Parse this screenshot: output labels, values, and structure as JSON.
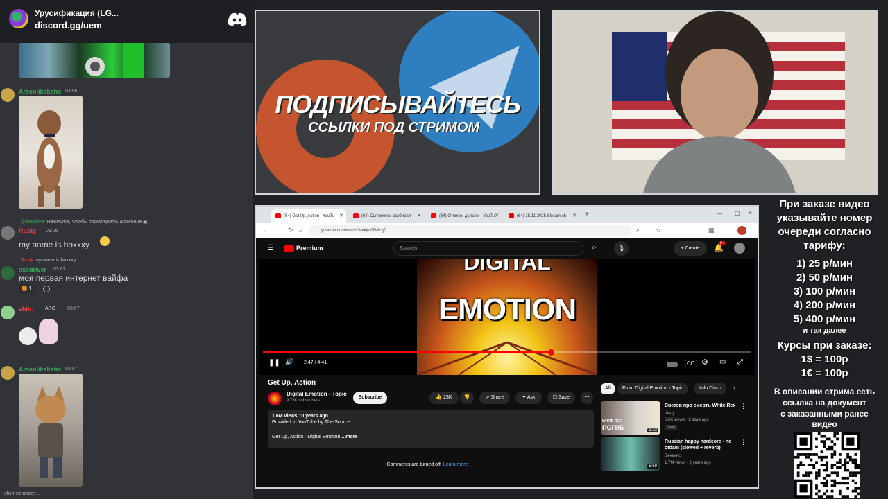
{
  "discord": {
    "server_name": "Урусификация (LG...",
    "invite": "discord.gg/uem",
    "messages": [
      {
        "user": "Arsenlikakaha",
        "user_color": "#3ba55c",
        "time": "03:06"
      },
      {
        "reply_user": "@assdriver",
        "reply_text": "Нажмите, чтобы посмотреть вложение",
        "user": "Rusty",
        "user_color": "#ed4245",
        "time": "03:06",
        "text": "my name is boxxxy"
      },
      {
        "reply_user": "Rusty",
        "reply_text": "my name is boxxxy",
        "user": "assdriver",
        "user_color": "#3ba55c",
        "time": "03:07",
        "text": "моя первая интернет вайфа",
        "reaction_count": "1"
      },
      {
        "user": "shlirr",
        "user_color": "#ed4245",
        "badge": "ARG",
        "time": "03:07"
      },
      {
        "user": "Arsenlikakaha",
        "user_color": "#3ba55c",
        "time": "03:07"
      }
    ],
    "typing": "shlirr печатает..."
  },
  "banner": {
    "headline": "ПОДПИСЫВАЙТЕСЬ",
    "subline": "ССЫЛКИ ПОД СТРИМОМ"
  },
  "browser": {
    "tabs": [
      {
        "label": "(64) Get Up, Action · YouTu"
      },
      {
        "label": "(64) Сытемочки разбирал"
      },
      {
        "label": "(64) Отписки делолм · YouTu"
      },
      {
        "label": "(64) 15.11.2025 Stream ch"
      }
    ],
    "url": "youtube.com/watch?v=kjfu0Zv8cg0"
  },
  "youtube": {
    "logo": "Premium",
    "search_placeholder": "Search",
    "create_label": "Create",
    "notif_count": "9+",
    "video_overlay_top": "DIGITAL",
    "video_overlay_main": "EMOTION",
    "progress": 0.59,
    "time": "2:47 / 4:41",
    "title": "Get Up, Action",
    "channel": "Digital Emotion - Topic",
    "subs": "9.78K subscribers",
    "subscribe": "Subscribe",
    "likes": "23K",
    "share": "Share",
    "ask": "Ask",
    "save": "Save",
    "desc_stats": "1.6M views  10 years ago",
    "desc_provided": "Provided to YouTube by The-Source",
    "desc_line": "Get Up, Action · Digital Emotion",
    "desc_more": "...more",
    "comments_off": "Comments are turned off.",
    "learn_more": "Learn more",
    "chips": [
      "All",
      "From Digital Emotion - Topic",
      "Italo Disco"
    ],
    "related": [
      {
        "title": "Светов про смерть White Rex",
        "channel": "desty",
        "stats": "6.6K views · 2 days ago",
        "badge": "New",
        "duration": "9:32",
        "thumb_text1": "WHITE REX",
        "thumb_text2": "ПОГИБ"
      },
      {
        "title": "Russian happy hardcore - ne otdam (slowed + reverb)",
        "channel": "Венкинс",
        "stats": "1.7M views · 2 years ago",
        "duration": "5:59"
      }
    ]
  },
  "info": {
    "intro": [
      "При заказе видео",
      "указывайте номер",
      "очереди согласно",
      "тарифу:"
    ],
    "tariffs": [
      "1) 25 р/мин",
      "2) 50 р/мин",
      "3) 100 р/мин",
      "4) 200 р/мин",
      "5) 400 р/мин"
    ],
    "etc": "и так далее",
    "rates_title": "Курсы при заказе:",
    "rates": [
      "1$ = 100р",
      "1€ = 100р"
    ],
    "doc_note": [
      "В описании стрима есть",
      "ссылка на документ",
      "с заказанными ранее",
      "видео"
    ]
  }
}
